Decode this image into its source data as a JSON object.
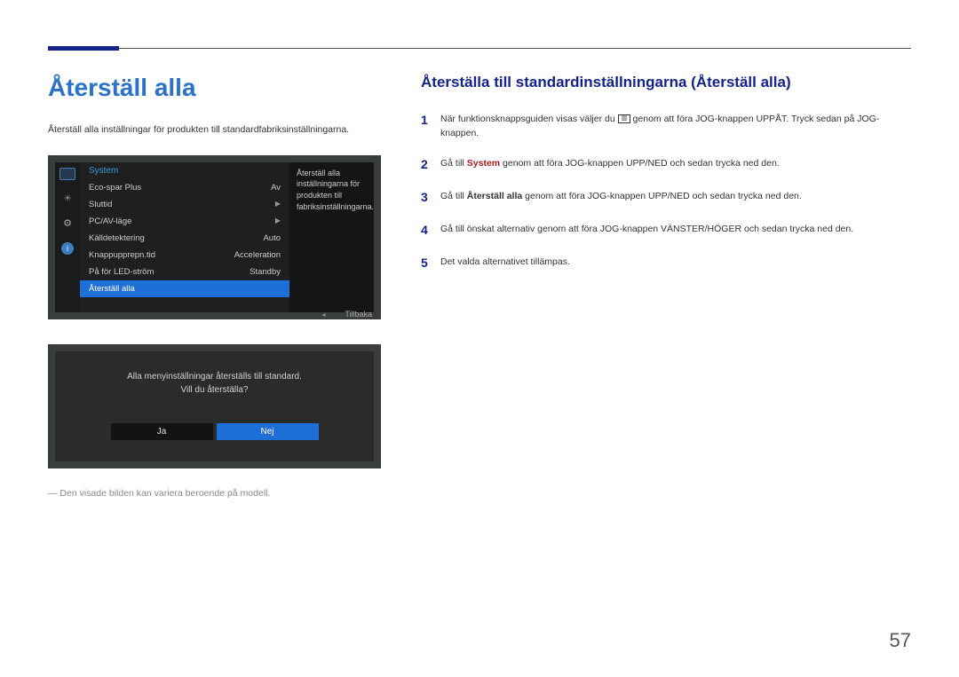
{
  "header": {
    "title": "Återställ alla",
    "intro": "Återställ alla inställningar för produkten till standardfabriksinställningarna."
  },
  "right": {
    "title": "Återställa till standardinställningarna (Återställ alla)",
    "steps": {
      "s1_pre": "När funktionsknappsguiden visas väljer du ",
      "s1_post": " genom att föra JOG-knappen UPPÅT. Tryck sedan på JOG-knappen.",
      "s2_pre": "Gå till ",
      "s2_bold": "System",
      "s2_post": " genom att föra JOG-knappen UPP/NED och sedan trycka ned den.",
      "s3_pre": "Gå till ",
      "s3_bold": "Återställ alla",
      "s3_post": " genom att föra JOG-knappen UPP/NED och sedan trycka ned den.",
      "s4": "Gå till önskat alternativ genom att föra JOG-knappen VÄNSTER/HÖGER och sedan trycka ned den.",
      "s5": "Det valda alternativet tillämpas."
    },
    "nums": {
      "n1": "1",
      "n2": "2",
      "n3": "3",
      "n4": "4",
      "n5": "5"
    }
  },
  "osd": {
    "header": "System",
    "rows": [
      {
        "label": "Eco-spar Plus",
        "value": "Av"
      },
      {
        "label": "Sluttid",
        "value": "▶"
      },
      {
        "label": "PC/AV-läge",
        "value": "▶"
      },
      {
        "label": "Källdetektering",
        "value": "Auto"
      },
      {
        "label": "Knappupprepn.tid",
        "value": "Acceleration"
      },
      {
        "label": "På för LED-ström",
        "value": "Standby"
      },
      {
        "label": "Återställ alla",
        "value": ""
      }
    ],
    "tooltip": "Återställ alla inställningarna för produkten till fabriksinställningarna.",
    "footer": "Tillbaka"
  },
  "dialog": {
    "line1": "Alla menyinställningar återställs till standard.",
    "line2": "Vill du återställa?",
    "yes": "Ja",
    "no": "Nej"
  },
  "caption": "Den visade bilden kan variera beroende på modell.",
  "page_number": "57",
  "icon_glyphs": {
    "menu": "▥",
    "info": "i"
  }
}
